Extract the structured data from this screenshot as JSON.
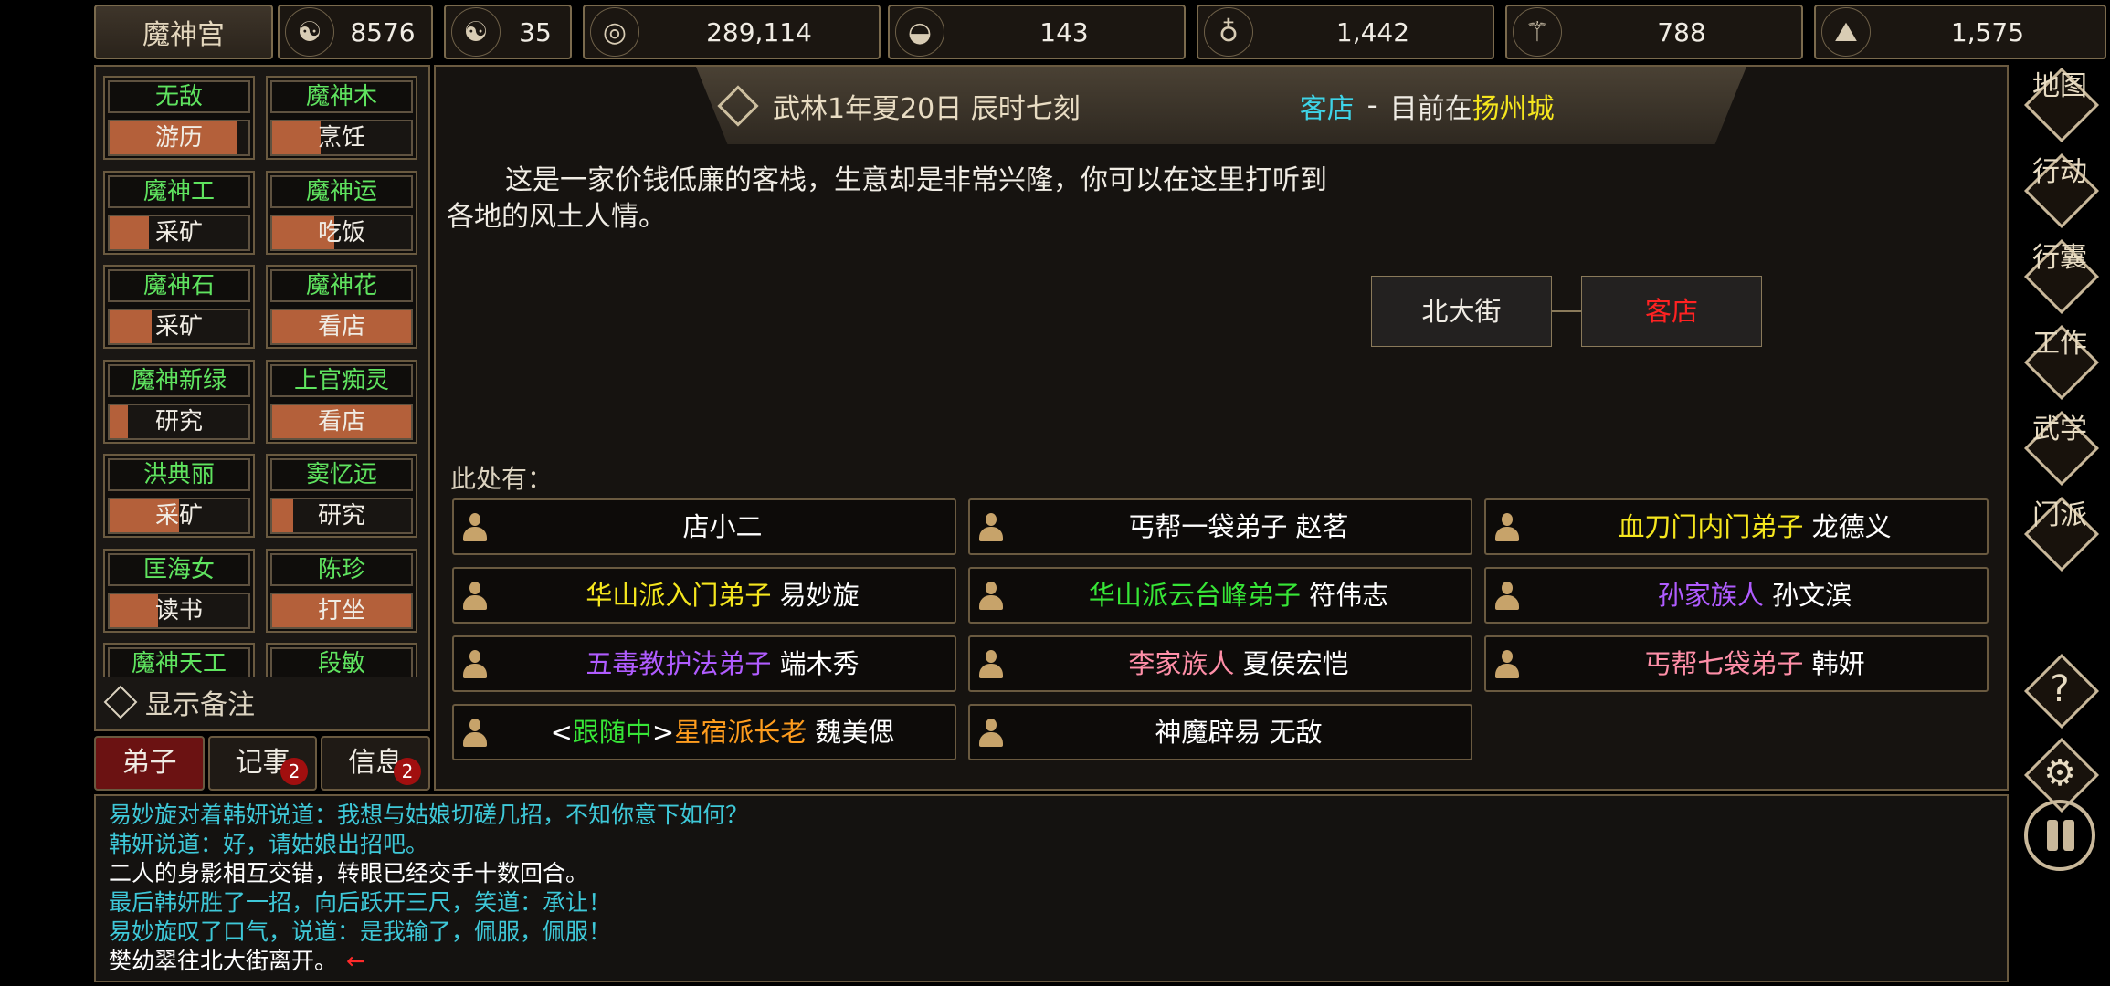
{
  "sect_name": "魔神宫",
  "resources": [
    {
      "icon": "reputation-icon",
      "value": "8576"
    },
    {
      "icon": "yin-yang-icon",
      "value": "35"
    },
    {
      "icon": "coin-icon",
      "value": "289,114"
    },
    {
      "icon": "food-bowl-icon",
      "value": "143"
    },
    {
      "icon": "herb-icon",
      "value": "1,442"
    },
    {
      "icon": "wood-icon",
      "value": "788"
    },
    {
      "icon": "ore-icon",
      "value": "1,575"
    }
  ],
  "disciples": [
    {
      "name": "无敌",
      "activity": "游历",
      "progress": 0.92
    },
    {
      "name": "魔神木",
      "activity": "烹饪",
      "progress": 0.35
    },
    {
      "name": "魔神工",
      "activity": "采矿",
      "progress": 0.28
    },
    {
      "name": "魔神运",
      "activity": "吃饭",
      "progress": 0.45
    },
    {
      "name": "魔神石",
      "activity": "采矿",
      "progress": 0.3
    },
    {
      "name": "魔神花",
      "activity": "看店",
      "progress": 1.0
    },
    {
      "name": "魔神新绿",
      "activity": "研究",
      "progress": 0.13
    },
    {
      "name": "上官痴灵",
      "activity": "看店",
      "progress": 1.0
    },
    {
      "name": "洪典丽",
      "activity": "采矿",
      "progress": 0.5
    },
    {
      "name": "窦忆远",
      "activity": "研究",
      "progress": 0.15
    },
    {
      "name": "匡海女",
      "activity": "读书",
      "progress": 0.35
    },
    {
      "name": "陈珍",
      "activity": "打坐",
      "progress": 1.0
    },
    {
      "name": "魔神天工",
      "activity": "",
      "progress": 0
    },
    {
      "name": "段敏",
      "activity": "",
      "progress": 0
    }
  ],
  "show_notes_label": "显示备注",
  "tabs": [
    {
      "label": "弟子",
      "badge": ""
    },
    {
      "label": "记事",
      "badge": "2"
    },
    {
      "label": "信息",
      "badge": "2"
    }
  ],
  "header": {
    "date": "武林1年夏20日 辰时七刻",
    "place": "客店",
    "separator": "-",
    "location_prefix": "目前在",
    "city": "扬州城"
  },
  "description": "这是一家价钱低廉的客栈，生意却是非常兴隆，你可以在这里打听到各地的风土人情。",
  "map": {
    "neighbor": "北大街",
    "current": "客店"
  },
  "here_label": "此处有：",
  "npcs": [
    {
      "parts": [
        {
          "t": "店小二",
          "c": "#ffffff"
        }
      ]
    },
    {
      "parts": [
        {
          "t": "丐帮一袋弟子",
          "c": "#ffffff"
        },
        {
          "t": " 赵茗",
          "c": "#ffffff"
        }
      ]
    },
    {
      "parts": [
        {
          "t": "血刀门内门弟子",
          "c": "#f5e61e"
        },
        {
          "t": " 龙德义",
          "c": "#ffffff"
        }
      ]
    },
    {
      "parts": [
        {
          "t": "华山派入门弟子",
          "c": "#f5e61e"
        },
        {
          "t": " 易妙旋",
          "c": "#ffffff"
        }
      ]
    },
    {
      "parts": [
        {
          "t": "华山派云台峰弟子",
          "c": "#37e637"
        },
        {
          "t": " 符伟志",
          "c": "#ffffff"
        }
      ]
    },
    {
      "parts": [
        {
          "t": "孙家族人",
          "c": "#b05cff"
        },
        {
          "t": " 孙文滨",
          "c": "#ffffff"
        }
      ]
    },
    {
      "parts": [
        {
          "t": "五毒教护法弟子",
          "c": "#b05cff"
        },
        {
          "t": " 端木秀",
          "c": "#ffffff"
        }
      ]
    },
    {
      "parts": [
        {
          "t": "李家族人",
          "c": "#ff8fa8"
        },
        {
          "t": " 夏侯宏恺",
          "c": "#ffffff"
        }
      ]
    },
    {
      "parts": [
        {
          "t": "丐帮七袋弟子",
          "c": "#ff8fa8"
        },
        {
          "t": " 韩妍",
          "c": "#ffffff"
        }
      ]
    },
    {
      "parts": [
        {
          "t": "<",
          "c": "#ffffff"
        },
        {
          "t": "跟随中",
          "c": "#37e637"
        },
        {
          "t": ">",
          "c": "#ffffff"
        },
        {
          "t": "星宿派长老",
          "c": "#ff9d1e"
        },
        {
          "t": " 魏美偲",
          "c": "#ffffff"
        }
      ]
    },
    {
      "parts": [
        {
          "t": "神魔辟易",
          "c": "#ffffff"
        },
        {
          "t": " 无敌",
          "c": "#ffffff"
        }
      ]
    }
  ],
  "log": [
    {
      "text": "易妙旋对着韩妍说道：我想与姑娘切磋几招，不知你意下如何？",
      "color": "#3ec8d8"
    },
    {
      "text": "韩妍说道：好，请姑娘出招吧。",
      "color": "#3ec8d8"
    },
    {
      "text": "二人的身影相互交错，转眼已经交手十数回合。",
      "color": "#ffffff"
    },
    {
      "text": "最后韩妍胜了一招，向后跃开三尺，笑道：承让！",
      "color": "#3ec8d8"
    },
    {
      "text": "易妙旋叹了口气，说道：是我输了，佩服，佩服！",
      "color": "#3ec8d8"
    },
    {
      "text": "樊幼翠往北大街离开。",
      "color": "#ffffff",
      "arrow": "←"
    }
  ],
  "menu": [
    "地图",
    "行动",
    "行囊",
    "工作",
    "武学",
    "门派"
  ],
  "menu_icons": [
    "help-icon",
    "settings-icon",
    "pause-icon"
  ]
}
